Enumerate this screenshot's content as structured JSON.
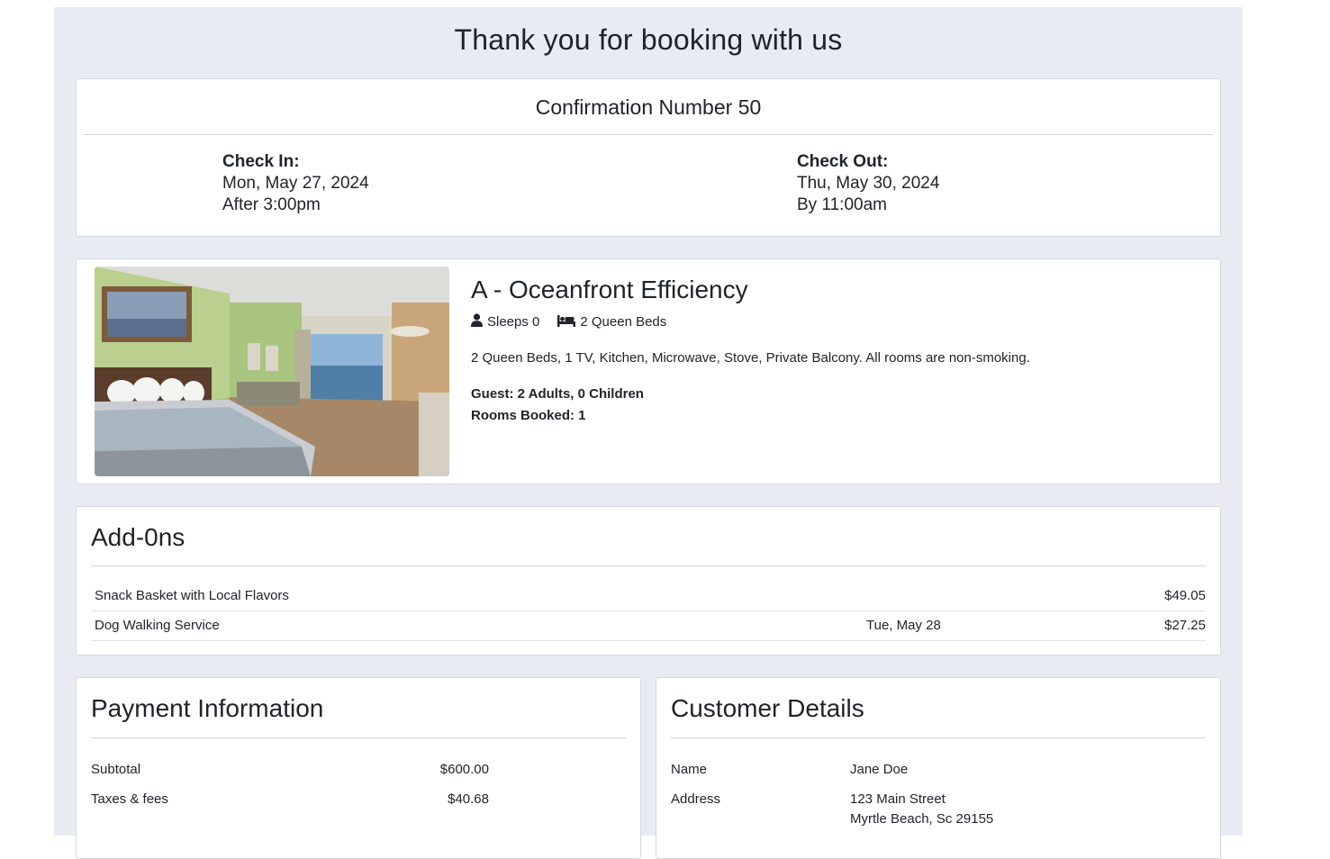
{
  "page": {
    "title": "Thank you for booking with us"
  },
  "confirmation": {
    "label": "Confirmation Number 50",
    "check_in": {
      "label": "Check In:",
      "date": "Mon, May 27, 2024",
      "time": "After 3:00pm"
    },
    "check_out": {
      "label": "Check Out:",
      "date": "Thu, May 30, 2024",
      "time": "By 11:00am"
    }
  },
  "room": {
    "name": "A - Oceanfront Efficiency",
    "sleeps": "Sleeps 0",
    "beds": "2 Queen Beds",
    "description": "2 Queen Beds, 1 TV, Kitchen, Microwave, Stove, Private Balcony. All rooms are non-smoking.",
    "guests": "Guest: 2 Adults, 0 Children",
    "rooms_booked": "Rooms Booked: 1",
    "icons": {
      "sleeps": "person-icon",
      "beds": "bed-icon"
    }
  },
  "addons": {
    "title": "Add-0ns",
    "items": [
      {
        "name": "Snack Basket with Local Flavors",
        "date": "",
        "price": "$49.05"
      },
      {
        "name": "Dog Walking Service",
        "date": "Tue, May 28",
        "price": "$27.25"
      }
    ]
  },
  "payment": {
    "title": "Payment Information",
    "rows": [
      {
        "label": "Subtotal",
        "value": "$600.00"
      },
      {
        "label": "Taxes & fees",
        "value": "$40.68"
      }
    ]
  },
  "customer": {
    "title": "Customer Details",
    "name_label": "Name",
    "name": "Jane Doe",
    "address_label": "Address",
    "address_line1": "123 Main Street",
    "address_line2": "Myrtle Beach, Sc 29155"
  },
  "colors": {
    "page_bg": "#e8ebf2",
    "card_bg": "#ffffff",
    "text": "#212529"
  }
}
